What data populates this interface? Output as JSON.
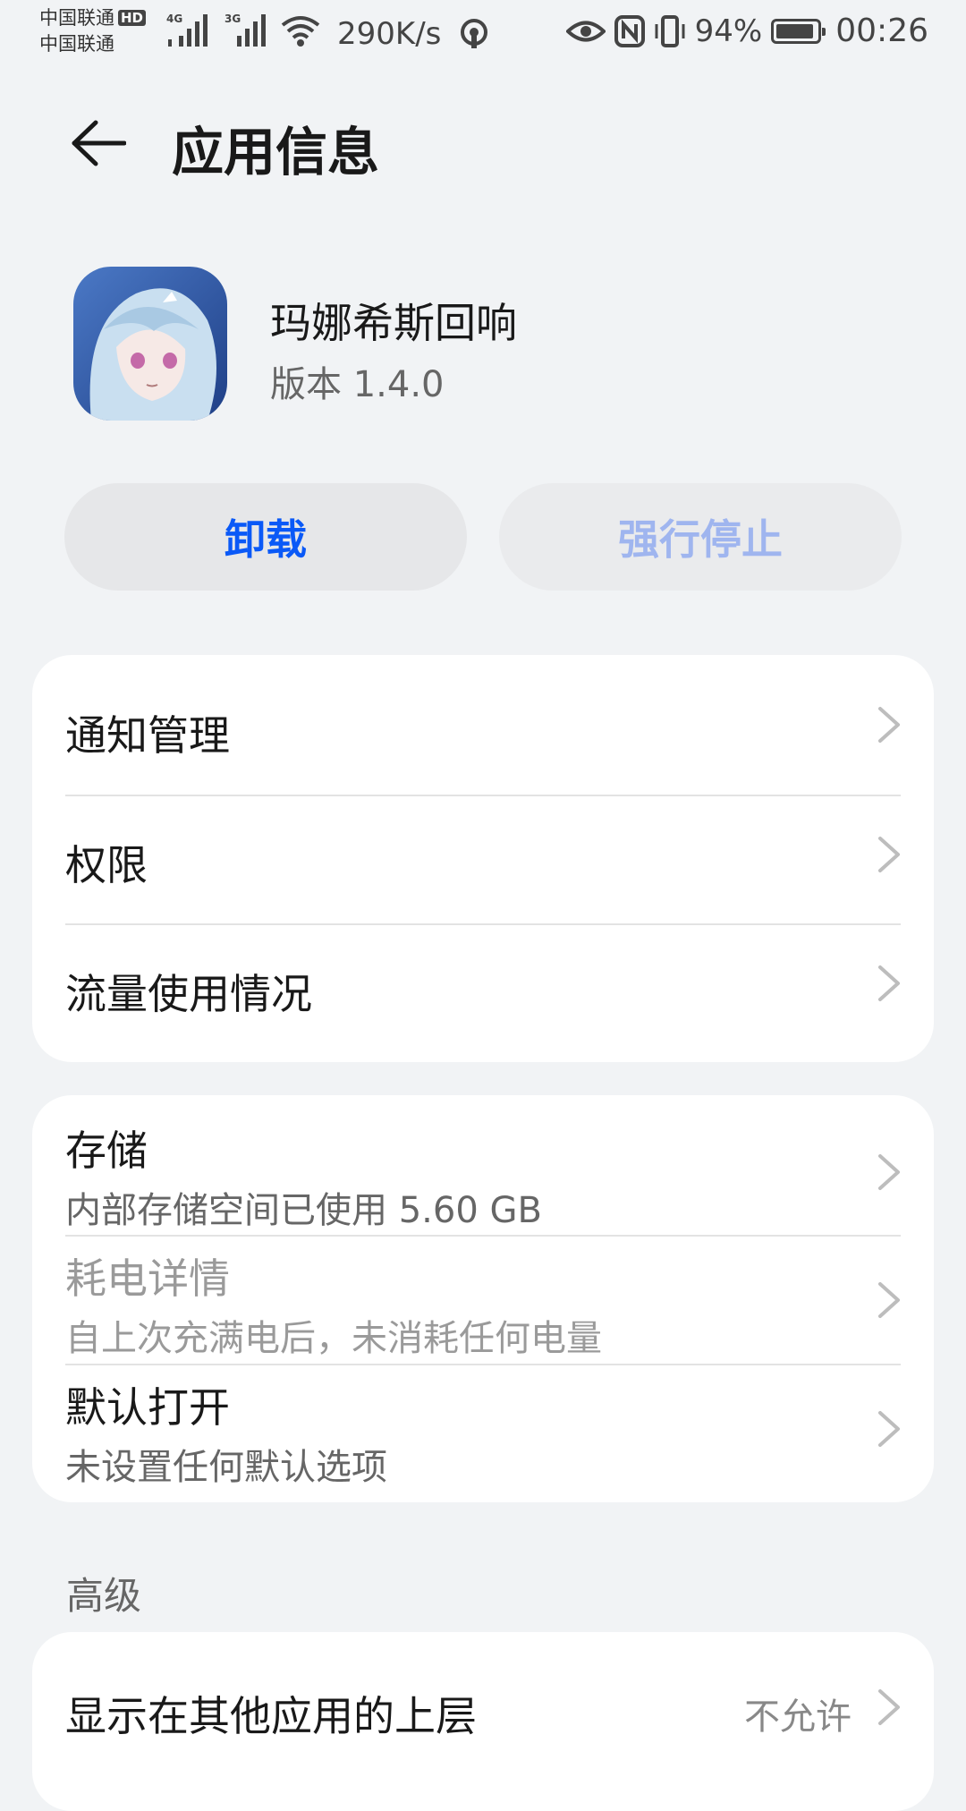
{
  "status_bar": {
    "carrier_1": "中国联通",
    "carrier_2": "中国联通",
    "hd": "HD",
    "net_1": "4G",
    "net_2": "3G",
    "speed": "290K/s",
    "battery_text": "94%",
    "battery_level": 0.94,
    "time": "00:26",
    "icons": [
      "hd-icon",
      "signal-icon",
      "signal-icon",
      "wifi-icon",
      "hotspot-icon",
      "eye-icon",
      "nfc-icon",
      "vibrate-icon",
      "battery-icon"
    ]
  },
  "header": {
    "title": "应用信息",
    "back_icon": "back-arrow-icon"
  },
  "app": {
    "name": "玛娜希斯回响",
    "version": "版本 1.4.0"
  },
  "actions": {
    "uninstall": "卸载",
    "force_stop": "强行停止"
  },
  "card1": {
    "items": [
      {
        "title": "通知管理"
      },
      {
        "title": "权限"
      },
      {
        "title": "流量使用情况"
      }
    ]
  },
  "card2": {
    "items": [
      {
        "title": "存储",
        "subtitle": "内部存储空间已使用 5.60 GB"
      },
      {
        "title": "耗电详情",
        "subtitle": "自上次充满电后，未消耗任何电量"
      },
      {
        "title": "默认打开",
        "subtitle": "未设置任何默认选项"
      }
    ]
  },
  "advanced": {
    "label": "高级",
    "items": [
      {
        "title": "显示在其他应用的上层",
        "value": "不允许"
      }
    ]
  },
  "colors": {
    "accent": "#0a59f7",
    "background": "#f1f3f5",
    "card": "#ffffff"
  }
}
